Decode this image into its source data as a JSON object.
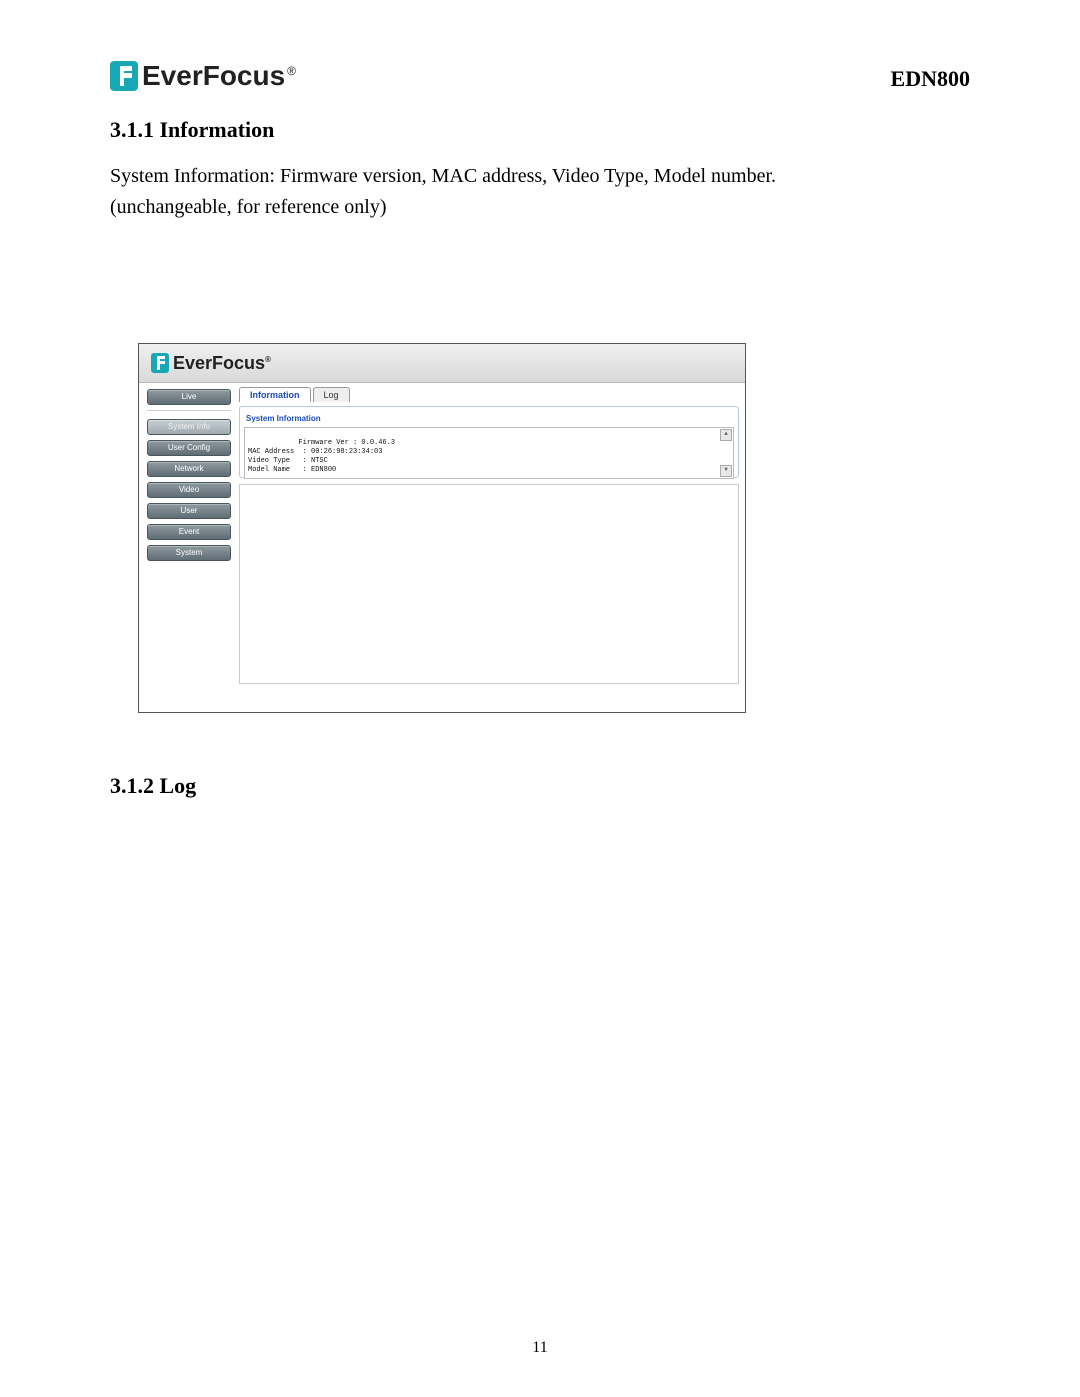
{
  "doc": {
    "brand": "EverFocus",
    "model": "EDN800",
    "page_number": "11",
    "section_311_no": "3.1.1 ",
    "section_311_title": "Information",
    "section_312_no": "3.1.2 ",
    "section_312_title": "Log",
    "body_line1": "System Information: Firmware version, MAC address, Video Type, Model number.",
    "body_line2": "(unchangeable, for reference only)"
  },
  "screenshot": {
    "brand": "EverFocus",
    "sidebar": {
      "live": "Live",
      "system_info": "System Info",
      "user_config": "User Config",
      "network": "Network",
      "video": "Video",
      "user": "User",
      "event": "Event",
      "system": "System"
    },
    "tabs": {
      "information": "Information",
      "log": "Log"
    },
    "fieldset_title": "System Information",
    "info_text": "Firmware Ver : 0.0.46.3\nMAC Address  : 00:26:98:23:34:03\nVideo Type   : NTSC\nModel Name   : EDN800"
  }
}
